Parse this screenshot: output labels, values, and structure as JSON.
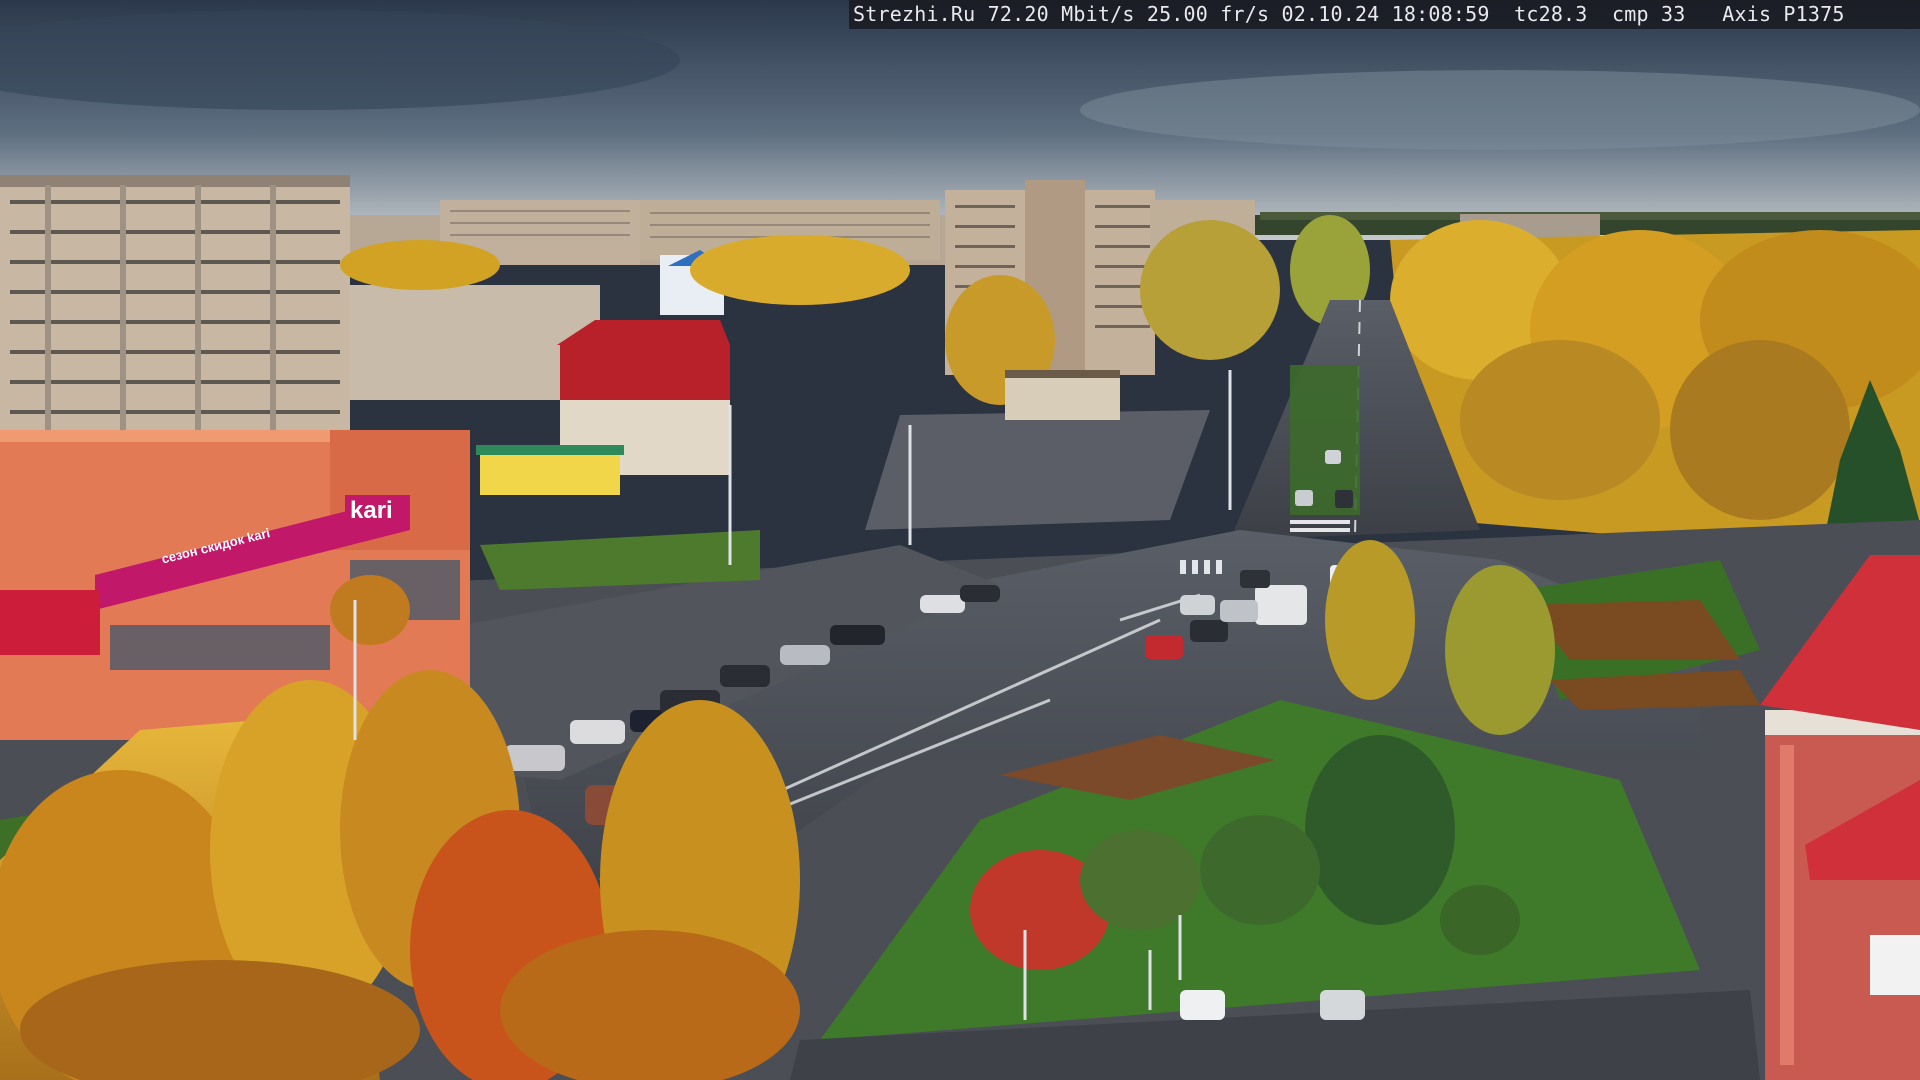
{
  "overlay": {
    "site": "Strezhi.Ru",
    "bitrate": "72.20 Mbit/s",
    "fps": "25.00 fr/s",
    "datetime": "02.10.24 18:08:59",
    "tc": "tc28.3",
    "cmp": "cmp 33",
    "camera": "Axis P1375"
  },
  "signs": {
    "store_brand": "kari",
    "store_banner": "сезон скидок kari"
  },
  "colors": {
    "sky_top": "#2d3a4e",
    "sky_bottom": "#c8cdd0",
    "foliage": "#d9a020",
    "road": "#4a4d55",
    "grass": "#3f7a2a",
    "kari_magenta": "#c2186a"
  }
}
